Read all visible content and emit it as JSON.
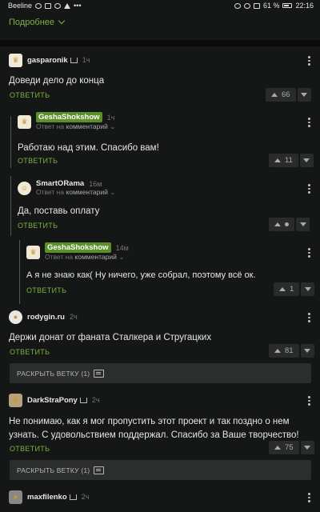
{
  "status": {
    "carrier": "Beeline",
    "battery": "61 %",
    "time": "22:16"
  },
  "more_label": "Подробнее",
  "reply_label": "ОТВЕТИТЬ",
  "reply_to_prefix": "Ответ на",
  "reply_to_word": "комментарий",
  "expand_label": "РАСКРЫТЬ ВЕТКУ (1)",
  "comments": [
    {
      "user": "gasparonik",
      "time": "1ч",
      "text": "Доведи дело до конца",
      "score": "66"
    },
    {
      "user": "GeshaShokshow",
      "time": "1ч",
      "text": "Работаю над этим. Спасибо вам!",
      "score": "11"
    },
    {
      "user": "SmartORama",
      "time": "16м",
      "text": "Да, поставь оплату",
      "score": ""
    },
    {
      "user": "GeshaShokshow",
      "time": "14м",
      "text": "А я не знаю как( Ну ничего, уже собрал, поэтому всё ок.",
      "score": "1"
    },
    {
      "user": "rodygin.ru",
      "time": "2ч",
      "text": "Держи донат от фаната Сталкера и Стругацких",
      "score": "81"
    },
    {
      "user": "DarkStraPony",
      "time": "2ч",
      "text": "Не понимаю, как я мог пропустить этот проект и так поздно о нем узнать. С удовольствием поддержал. Спасибо за Ваше творчество!",
      "score": "75"
    },
    {
      "user": "maxfilenko",
      "time": "2ч",
      "text": "",
      "score": ""
    }
  ],
  "colors": {
    "accent": "#7cb342",
    "badge": "#5b8f2a",
    "background": "#151616",
    "panel": "#2c2d2d"
  }
}
